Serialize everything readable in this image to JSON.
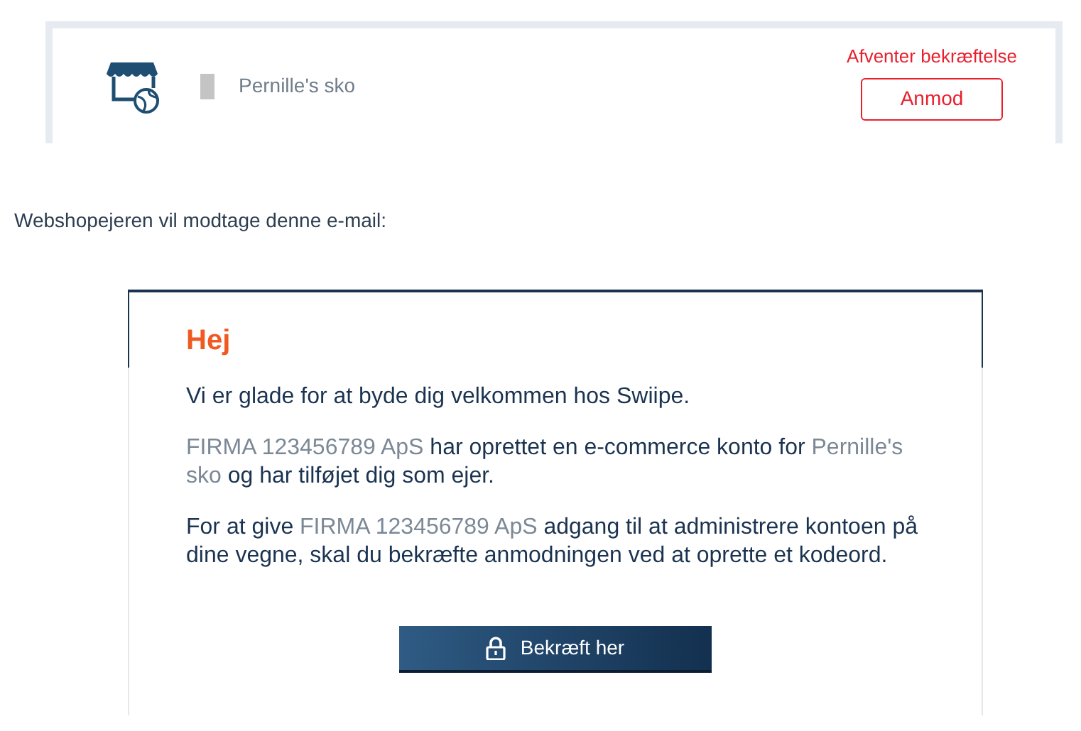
{
  "shop": {
    "name": "Pernille's sko",
    "status": "Afventer bekræftelse",
    "button": "Anmod"
  },
  "intro": "Webshopejeren vil modtage denne e-mail:",
  "email": {
    "greeting": "Hej",
    "paragraphs": [
      [
        {
          "text": "Vi er glade for at byde dig velkommen hos Swiipe.",
          "blurred": false
        }
      ],
      [
        {
          "text": "FIRMA 123456789 ApS",
          "blurred": true
        },
        {
          "text": " har oprettet en e-commerce konto for ",
          "blurred": false
        },
        {
          "text": "Pernille's sko",
          "blurred": true
        },
        {
          "text": " og har tilføjet dig som ejer.",
          "blurred": false
        }
      ],
      [
        {
          "text": "For at give ",
          "blurred": false
        },
        {
          "text": "FIRMA 123456789 ApS",
          "blurred": true
        },
        {
          "text": " adgang til at administrere kontoen på dine vegne, skal du bekræfte anmodningen ved at oprette et kodeord.",
          "blurred": false
        }
      ]
    ],
    "button": "Bekræft her"
  }
}
